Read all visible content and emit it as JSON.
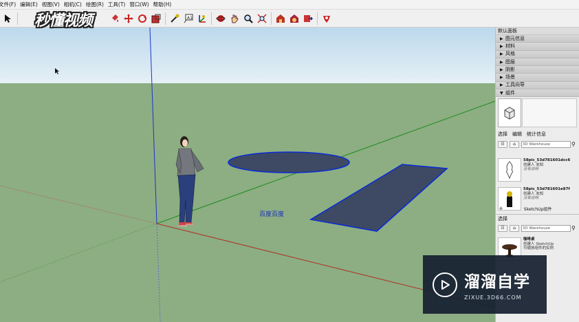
{
  "menu": {
    "items": [
      "文件(F)",
      "编辑(E)",
      "视图(V)",
      "相机(C)",
      "绘图(R)",
      "工具(T)",
      "窗口(W)",
      "帮助(H)"
    ]
  },
  "toolbar": {
    "icons": [
      "select-arrow",
      "eraser",
      "paint-bucket",
      "move",
      "rotate",
      "scale",
      "tape-measure",
      "text",
      "axes",
      "orbit",
      "pan",
      "zoom",
      "zoom-extents",
      "warehouse",
      "share-model",
      "get-models",
      "extension-warehouse"
    ]
  },
  "watermark": {
    "logo_text": "秒懂视频"
  },
  "viewport": {
    "scene_label": "百度百度"
  },
  "panel": {
    "title": "默认面板",
    "trays": [
      {
        "label": "图元信息",
        "expanded": false
      },
      {
        "label": "材料",
        "expanded": false
      },
      {
        "label": "风格",
        "expanded": false
      },
      {
        "label": "图层",
        "expanded": false
      },
      {
        "label": "阴影",
        "expanded": false
      },
      {
        "label": "场景",
        "expanded": false
      },
      {
        "label": "工具向导",
        "expanded": false
      },
      {
        "label": "组件",
        "expanded": true
      }
    ],
    "tabs": [
      "选择",
      "编辑",
      "统计信息"
    ],
    "search_placeholder": "3D Warehouse",
    "results": [
      {
        "name": "58pic_53d781601dcc6",
        "author": "创建人 未知",
        "note": "没有说明"
      },
      {
        "name": "58pic_53d781601e87f",
        "author": "创建人 未知",
        "note": "没有说明"
      }
    ],
    "sketchup_label": "SketchUp组件",
    "section2_label": "选择",
    "search2_placeholder": "3D Warehouse",
    "result3": {
      "name": "咖啡桌",
      "author": "创建人 SketchUp",
      "desc": "可缩放组件的实例"
    }
  },
  "brand": {
    "name": "溜溜自学",
    "url": "ZIXUE.3D66.COM"
  },
  "colors": {
    "sky": "#d4e6f1",
    "ground": "#8cae82",
    "shape_fill": "#3e4a63",
    "shape_edge": "#0a2bd6",
    "axis_red": "#b0322a",
    "axis_green": "#1d8a1d",
    "axis_blue": "#1f2fd0",
    "brand_bg": "#16202f"
  }
}
